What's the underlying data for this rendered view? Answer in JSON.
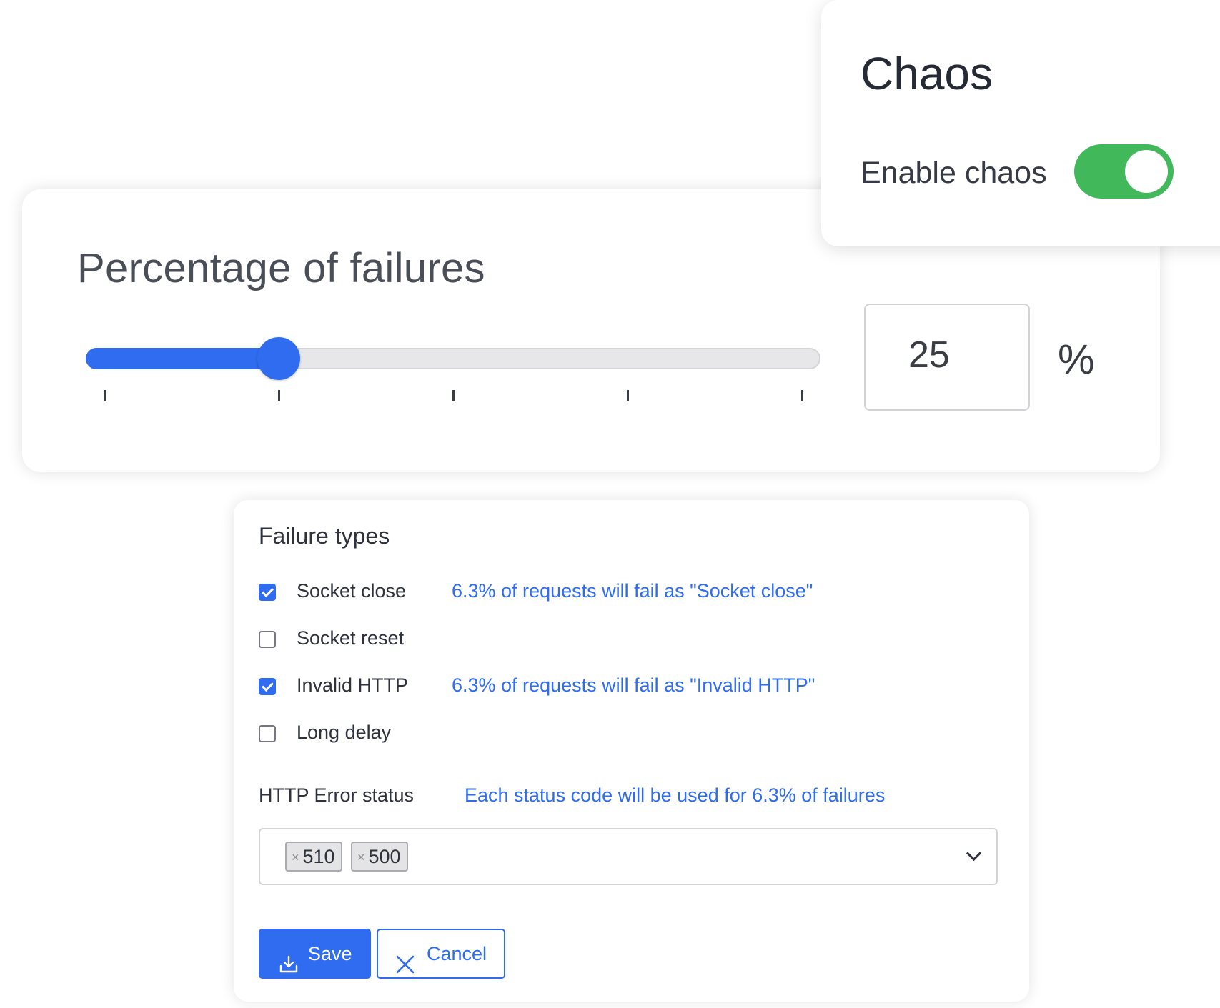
{
  "chaos": {
    "title": "Chaos",
    "toggle_label": "Enable chaos",
    "enabled": true,
    "toggle_color": "#41b85a"
  },
  "percentage": {
    "title": "Percentage of failures",
    "value": "25",
    "unit": "%",
    "slider_value": 25,
    "slider_min": 0,
    "slider_max": 100,
    "slider_tick_count": 5,
    "accent_color": "#2f6cf0"
  },
  "failure_types": {
    "title": "Failure types",
    "items": [
      {
        "label": "Socket close",
        "checked": true,
        "note": "6.3% of requests will fail as \"Socket close\""
      },
      {
        "label": "Socket reset",
        "checked": false,
        "note": ""
      },
      {
        "label": "Invalid HTTP",
        "checked": true,
        "note": "6.3% of requests will fail as \"Invalid HTTP\""
      },
      {
        "label": "Long delay",
        "checked": false,
        "note": ""
      }
    ]
  },
  "http_error": {
    "label": "HTTP Error status",
    "note": "Each status code will be used for 6.3% of failures",
    "tags": [
      "510",
      "500"
    ],
    "remove_symbol": "×"
  },
  "actions": {
    "save_label": "Save",
    "save_icon": "download-icon",
    "cancel_label": "Cancel",
    "cancel_icon": "close-icon"
  }
}
